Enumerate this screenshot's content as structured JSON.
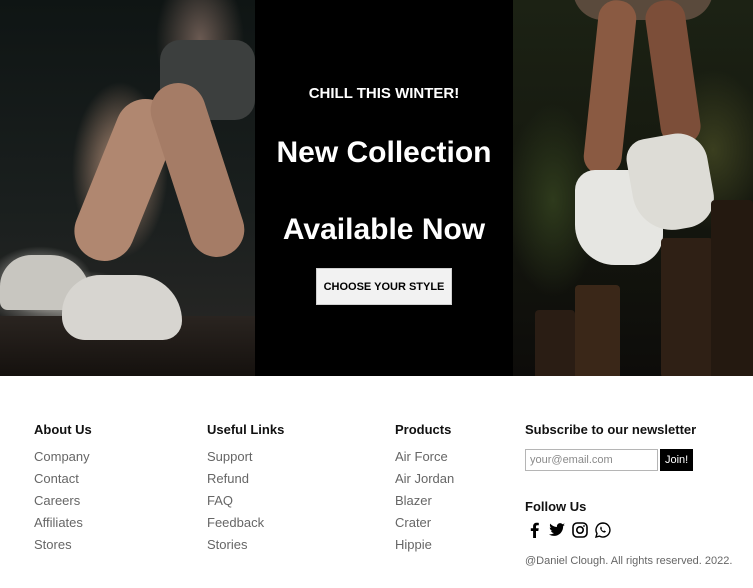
{
  "hero": {
    "eyebrow": "CHILL THIS WINTER!",
    "headline_line1": "New Collection",
    "headline_line2": "Available Now",
    "cta_label": "CHOOSE YOUR STYLE"
  },
  "footer": {
    "about": {
      "heading": "About Us",
      "items": [
        "Company",
        "Contact",
        "Careers",
        "Affiliates",
        "Stores"
      ]
    },
    "useful": {
      "heading": "Useful Links",
      "items": [
        "Support",
        "Refund",
        "FAQ",
        "Feedback",
        "Stories"
      ]
    },
    "products": {
      "heading": "Products",
      "items": [
        "Air Force",
        "Air Jordan",
        "Blazer",
        "Crater",
        "Hippie"
      ]
    },
    "newsletter": {
      "heading": "Subscribe to our newsletter",
      "placeholder": "your@email.com",
      "button_label": "Join!",
      "follow_heading": "Follow Us",
      "socials": [
        "facebook-icon",
        "twitter-icon",
        "instagram-icon",
        "whatsapp-icon"
      ],
      "copyright": "@Daniel Clough. All rights reserved. 2022."
    }
  }
}
